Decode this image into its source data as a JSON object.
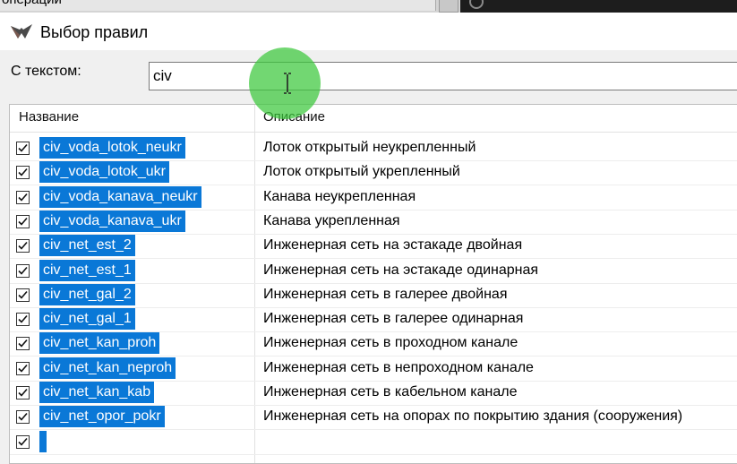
{
  "top": {
    "prev_window_text": "операции"
  },
  "dialog": {
    "title": "Выбор правил"
  },
  "filter": {
    "label": "С текстом:",
    "value": "civ"
  },
  "table": {
    "columns": {
      "name": "Название",
      "description": "Описание"
    },
    "rows": [
      {
        "name": "civ_voda_lotok_neukr",
        "description": "Лоток открытый неукрепленный",
        "checked": true
      },
      {
        "name": "civ_voda_lotok_ukr",
        "description": "Лоток открытый укрепленный",
        "checked": true
      },
      {
        "name": "civ_voda_kanava_neukr",
        "description": "Канава неукрепленная",
        "checked": true
      },
      {
        "name": "civ_voda_kanava_ukr",
        "description": "Канава укрепленная",
        "checked": true
      },
      {
        "name": "civ_net_est_2",
        "description": "Инженерная сеть на эстакаде двойная",
        "checked": true
      },
      {
        "name": "civ_net_est_1",
        "description": "Инженерная сеть на эстакаде одинарная",
        "checked": true
      },
      {
        "name": "civ_net_gal_2",
        "description": "Инженерная сеть в галерее двойная",
        "checked": true
      },
      {
        "name": "civ_net_gal_1",
        "description": "Инженерная сеть в галерее одинарная",
        "checked": true
      },
      {
        "name": "civ_net_kan_proh",
        "description": "Инженерная сеть в проходном канале",
        "checked": true
      },
      {
        "name": "civ_net_kan_neproh",
        "description": "Инженерная сеть в непроходном канале",
        "checked": true
      },
      {
        "name": "civ_net_kan_kab",
        "description": "Инженерная сеть в кабельном канале",
        "checked": true
      },
      {
        "name": "civ_net_opor_pokr",
        "description": "Инженерная сеть на опорах по покрытию здания (сооружения)",
        "checked": true
      },
      {
        "name": "",
        "description": "",
        "checked": true
      }
    ]
  },
  "colors": {
    "selection": "#0a78d7",
    "cursor_highlight": "#3cc83c"
  }
}
